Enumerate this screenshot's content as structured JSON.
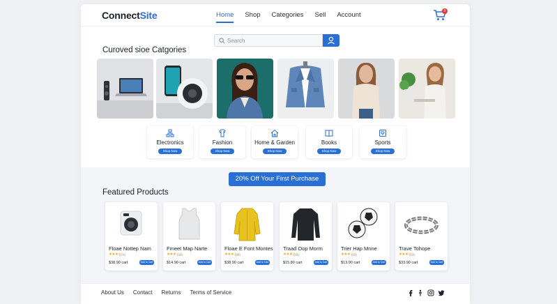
{
  "header": {
    "logo_main": "Connect",
    "logo_accent": "Site",
    "nav": [
      "Home",
      "Shop",
      "Categories",
      "Sell",
      "Account"
    ],
    "active_nav": "Home",
    "cart_count": "0"
  },
  "search": {
    "placeholder": "Search"
  },
  "categories": {
    "title": "Curoved sioe Catgories",
    "tiles": [
      "Electronics",
      "Fashion",
      "Home & Garden",
      "Books",
      "Sports"
    ],
    "cards": [
      {
        "name": "Electronics",
        "button": "Shop Now",
        "icon": "sitemap-icon"
      },
      {
        "name": "Fashion",
        "button": "Shop Now",
        "icon": "clothes-icon"
      },
      {
        "name": "Home & Garden",
        "button": "Shop Now",
        "icon": "house-icon"
      },
      {
        "name": "Books",
        "button": "Shop Now",
        "icon": "book-icon"
      },
      {
        "name": "Sports",
        "button": "Shop Now",
        "icon": "trophy-icon"
      }
    ]
  },
  "promo": {
    "label": "20% Off Your First Purchase"
  },
  "featured": {
    "title": "Featured Products",
    "products": [
      {
        "name": "Floae Nottep Nam",
        "rating_count": "(1.8)",
        "price": "$38.90 cart",
        "button": "Add to Cart"
      },
      {
        "name": "Fmeet Map Narte",
        "rating_count": "(22)",
        "price": "$14.90 cart",
        "button": "Add to Cart"
      },
      {
        "name": "Floae E Font Montes",
        "rating_count": "(88)",
        "price": "$38.90 cart",
        "button": "Add to Cart"
      },
      {
        "name": "Traad Oop Morm",
        "rating_count": "(18)",
        "price": "$15.80 cart",
        "button": "Add to Cart"
      },
      {
        "name": "Trier Hap Mnne",
        "rating_count": "(13)",
        "price": "$13.90 cart",
        "button": "Add to Cart"
      },
      {
        "name": "Trave Tohope",
        "rating_count": "(13)",
        "price": "$33.90 cart",
        "button": "Add to Cart"
      }
    ],
    "stars": "★★★☆☆"
  },
  "footer": {
    "links": [
      "About Us",
      "Contact",
      "Returns",
      "Terms of Service"
    ],
    "social": [
      "facebook-icon",
      "tiktok-icon",
      "instagram-icon",
      "twitter-icon"
    ]
  },
  "colors": {
    "accent": "#2a6fd6",
    "badge": "#e53935",
    "star": "#f5a623"
  }
}
